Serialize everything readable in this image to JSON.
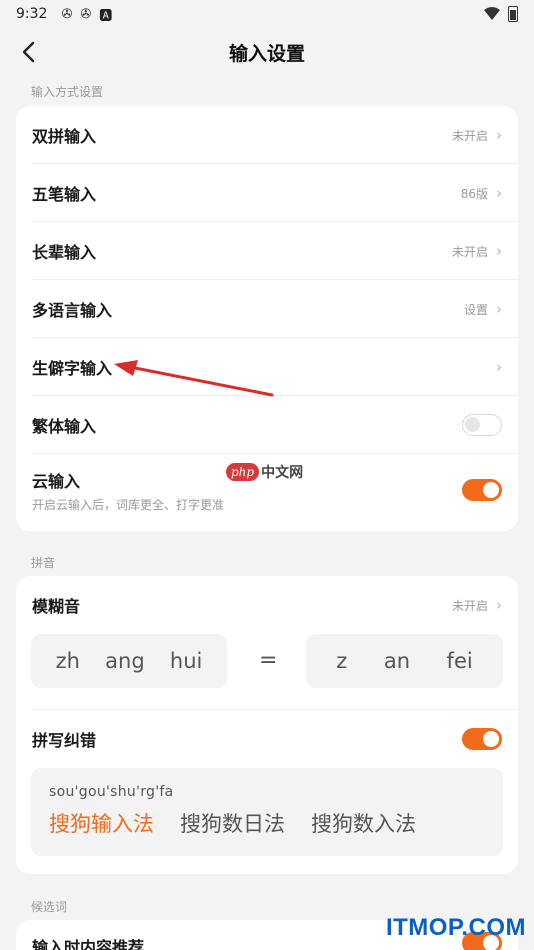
{
  "status": {
    "time": "9:32"
  },
  "header": {
    "title": "输入设置"
  },
  "sections": {
    "input_methods": "输入方式设置",
    "pinyin": "拼音",
    "candidates": "候选词"
  },
  "input_rows": [
    {
      "label": "双拼输入",
      "value": "未开启"
    },
    {
      "label": "五笔输入",
      "value": "86版"
    },
    {
      "label": "长辈输入",
      "value": "未开启"
    },
    {
      "label": "多语言输入",
      "value": "设置"
    },
    {
      "label": "生僻字输入",
      "value": ""
    }
  ],
  "traditional": {
    "label": "繁体输入",
    "on": false
  },
  "cloud": {
    "label": "云输入",
    "desc": "开启云输入后，词库更全、打字更准",
    "on": true
  },
  "fuzzy": {
    "label": "模糊音",
    "value": "未开启",
    "left": [
      "zh",
      "ang",
      "hui"
    ],
    "equals": "=",
    "right": [
      "z",
      "an",
      "fei"
    ]
  },
  "spell": {
    "label": "拼写纠错",
    "on": true,
    "pinyin": "sou'gou'shu'rg'fa",
    "words": [
      "搜狗输入法",
      "搜狗数日法",
      "搜狗数入法"
    ]
  },
  "recommend": {
    "label": "输入时内容推荐",
    "on": true
  },
  "watermarks": {
    "php": "php",
    "cn": "中文网",
    "site": "ITMOP.COM"
  },
  "colors": {
    "accent": "#f26b1d",
    "background": "#f3f3f5"
  }
}
